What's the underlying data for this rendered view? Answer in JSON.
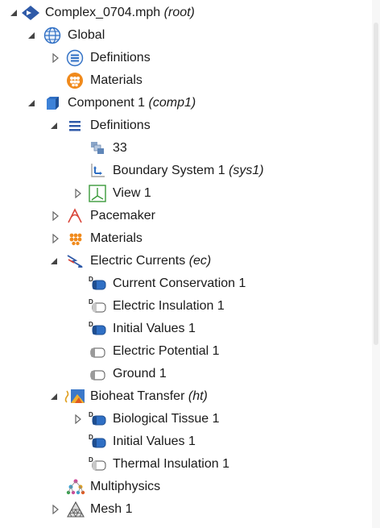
{
  "tree": {
    "rows": [
      {
        "label": "Complex_0704.mph",
        "suffix": "(root)",
        "icon": "model-root-icon"
      },
      {
        "label": "Global",
        "suffix": "",
        "icon": "globe-icon"
      },
      {
        "label": "Definitions",
        "suffix": "",
        "icon": "global-definitions-icon"
      },
      {
        "label": "Materials",
        "suffix": "",
        "icon": "materials-icon"
      },
      {
        "label": "Component 1",
        "suffix": "(comp1)",
        "icon": "component-cube-icon"
      },
      {
        "label": "Definitions",
        "suffix": "",
        "icon": "definitions-icon"
      },
      {
        "label": "33",
        "suffix": "",
        "icon": "selection-icon"
      },
      {
        "label": "Boundary System 1",
        "suffix": "(sys1)",
        "icon": "boundary-system-icon"
      },
      {
        "label": "View 1",
        "suffix": "",
        "icon": "view-icon"
      },
      {
        "label": "Pacemaker",
        "suffix": "",
        "icon": "geometry-icon"
      },
      {
        "label": "Materials",
        "suffix": "",
        "icon": "materials-small-icon"
      },
      {
        "label": "Electric Currents",
        "suffix": "(ec)",
        "icon": "electric-currents-icon"
      },
      {
        "label": "Current Conservation 1",
        "suffix": "",
        "icon": "domain-feature-icon"
      },
      {
        "label": "Electric Insulation 1",
        "suffix": "",
        "icon": "domain-feature-icon"
      },
      {
        "label": "Initial Values 1",
        "suffix": "",
        "icon": "domain-feature-icon"
      },
      {
        "label": "Electric Potential 1",
        "suffix": "",
        "icon": "boundary-feature-icon"
      },
      {
        "label": "Ground 1",
        "suffix": "",
        "icon": "boundary-feature-icon"
      },
      {
        "label": "Bioheat Transfer",
        "suffix": "(ht)",
        "icon": "bioheat-icon"
      },
      {
        "label": "Biological Tissue 1",
        "suffix": "",
        "icon": "domain-feature-icon"
      },
      {
        "label": "Initial Values 1",
        "suffix": "",
        "icon": "domain-feature-icon"
      },
      {
        "label": "Thermal Insulation 1",
        "suffix": "",
        "icon": "boundary-feature-icon"
      },
      {
        "label": "Multiphysics",
        "suffix": "",
        "icon": "multiphysics-icon"
      },
      {
        "label": "Mesh 1",
        "suffix": "",
        "icon": "mesh-icon"
      }
    ]
  },
  "colors": {
    "accent": "#2f6fc4",
    "text": "#1a1a1a",
    "toggle": "#444444"
  }
}
